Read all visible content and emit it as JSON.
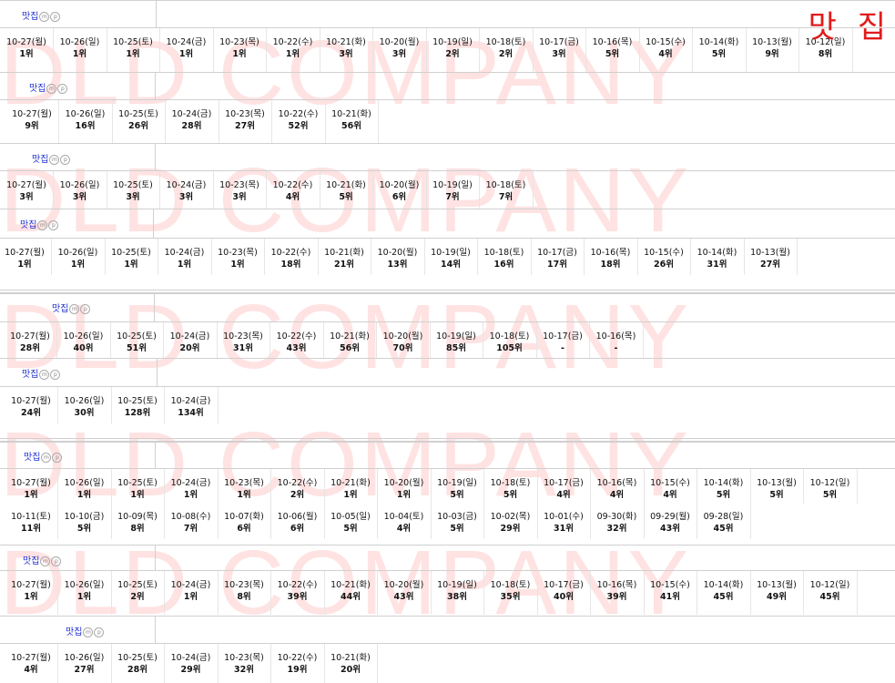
{
  "watermark": "DLD COMPANY",
  "corner_label": "맛 집",
  "icons": [
    "m-icon",
    "p-icon"
  ],
  "blocks": [
    {
      "keyword": "맛집",
      "rows": [
        [
          [
            "10-27(월)",
            "1위"
          ],
          [
            "10-26(일)",
            "1위"
          ],
          [
            "10-25(토)",
            "1위"
          ],
          [
            "10-24(금)",
            "1위"
          ],
          [
            "10-23(목)",
            "1위"
          ],
          [
            "10-22(수)",
            "1위"
          ],
          [
            "10-21(화)",
            "3위"
          ],
          [
            "10-20(월)",
            "3위"
          ],
          [
            "10-19(일)",
            "2위"
          ],
          [
            "10-18(토)",
            "2위"
          ],
          [
            "10-17(금)",
            "3위"
          ],
          [
            "10-16(목)",
            "5위"
          ],
          [
            "10-15(수)",
            "4위"
          ],
          [
            "10-14(화)",
            "5위"
          ],
          [
            "10-13(월)",
            "9위"
          ],
          [
            "10-12(일)",
            "8위"
          ]
        ]
      ]
    },
    {
      "keyword": "맛집",
      "rows": [
        [
          [
            "10-27(월)",
            "9위"
          ],
          [
            "10-26(일)",
            "16위"
          ],
          [
            "10-25(토)",
            "26위"
          ],
          [
            "10-24(금)",
            "28위"
          ],
          [
            "10-23(목)",
            "27위"
          ],
          [
            "10-22(수)",
            "52위"
          ],
          [
            "10-21(화)",
            "56위"
          ]
        ]
      ]
    },
    {
      "keyword": "맛집",
      "rows": [
        [
          [
            "10-27(월)",
            "3위"
          ],
          [
            "10-26(일)",
            "3위"
          ],
          [
            "10-25(토)",
            "3위"
          ],
          [
            "10-24(금)",
            "3위"
          ],
          [
            "10-23(목)",
            "3위"
          ],
          [
            "10-22(수)",
            "4위"
          ],
          [
            "10-21(화)",
            "5위"
          ],
          [
            "10-20(월)",
            "6위"
          ],
          [
            "10-19(일)",
            "7위"
          ],
          [
            "10-18(토)",
            "7위"
          ]
        ]
      ]
    },
    {
      "keyword": "맛집",
      "rows": [
        [
          [
            "10-27(월)",
            "1위"
          ],
          [
            "10-26(일)",
            "1위"
          ],
          [
            "10-25(토)",
            "1위"
          ],
          [
            "10-24(금)",
            "1위"
          ],
          [
            "10-23(목)",
            "1위"
          ],
          [
            "10-22(수)",
            "18위"
          ],
          [
            "10-21(화)",
            "21위"
          ],
          [
            "10-20(월)",
            "13위"
          ],
          [
            "10-19(일)",
            "14위"
          ],
          [
            "10-18(토)",
            "16위"
          ],
          [
            "10-17(금)",
            "17위"
          ],
          [
            "10-16(목)",
            "18위"
          ],
          [
            "10-15(수)",
            "26위"
          ],
          [
            "10-14(화)",
            "31위"
          ],
          [
            "10-13(월)",
            "27위"
          ]
        ]
      ]
    },
    {
      "keyword": "맛집",
      "rows": [
        [
          [
            "10-27(월)",
            "28위"
          ],
          [
            "10-26(일)",
            "40위"
          ],
          [
            "10-25(토)",
            "51위"
          ],
          [
            "10-24(금)",
            "20위"
          ],
          [
            "10-23(목)",
            "31위"
          ],
          [
            "10-22(수)",
            "43위"
          ],
          [
            "10-21(화)",
            "56위"
          ],
          [
            "10-20(월)",
            "70위"
          ],
          [
            "10-19(일)",
            "85위"
          ],
          [
            "10-18(토)",
            "105위"
          ],
          [
            "10-17(금)",
            "-"
          ],
          [
            "10-16(목)",
            "-"
          ]
        ]
      ]
    },
    {
      "keyword": "맛집",
      "rows": [
        [
          [
            "10-27(월)",
            "24위"
          ],
          [
            "10-26(일)",
            "30위"
          ],
          [
            "10-25(토)",
            "128위"
          ],
          [
            "10-24(금)",
            "134위"
          ]
        ]
      ]
    },
    {
      "keyword": "맛집",
      "rows": [
        [
          [
            "10-27(월)",
            "1위"
          ],
          [
            "10-26(일)",
            "1위"
          ],
          [
            "10-25(토)",
            "1위"
          ],
          [
            "10-24(금)",
            "1위"
          ],
          [
            "10-23(목)",
            "1위"
          ],
          [
            "10-22(수)",
            "2위"
          ],
          [
            "10-21(화)",
            "1위"
          ],
          [
            "10-20(월)",
            "1위"
          ],
          [
            "10-19(일)",
            "5위"
          ],
          [
            "10-18(토)",
            "5위"
          ],
          [
            "10-17(금)",
            "4위"
          ],
          [
            "10-16(목)",
            "4위"
          ],
          [
            "10-15(수)",
            "4위"
          ],
          [
            "10-14(화)",
            "5위"
          ],
          [
            "10-13(월)",
            "5위"
          ],
          [
            "10-12(일)",
            "5위"
          ]
        ],
        [
          [
            "10-11(토)",
            "11위"
          ],
          [
            "10-10(금)",
            "5위"
          ],
          [
            "10-09(목)",
            "8위"
          ],
          [
            "10-08(수)",
            "7위"
          ],
          [
            "10-07(화)",
            "6위"
          ],
          [
            "10-06(월)",
            "6위"
          ],
          [
            "10-05(일)",
            "5위"
          ],
          [
            "10-04(토)",
            "4위"
          ],
          [
            "10-03(금)",
            "5위"
          ],
          [
            "10-02(목)",
            "29위"
          ],
          [
            "10-01(수)",
            "31위"
          ],
          [
            "09-30(화)",
            "32위"
          ],
          [
            "09-29(월)",
            "43위"
          ],
          [
            "09-28(일)",
            "45위"
          ]
        ]
      ]
    },
    {
      "keyword": "맛집",
      "rows": [
        [
          [
            "10-27(월)",
            "1위"
          ],
          [
            "10-26(일)",
            "1위"
          ],
          [
            "10-25(토)",
            "2위"
          ],
          [
            "10-24(금)",
            "1위"
          ],
          [
            "10-23(목)",
            "8위"
          ],
          [
            "10-22(수)",
            "39위"
          ],
          [
            "10-21(화)",
            "44위"
          ],
          [
            "10-20(월)",
            "43위"
          ],
          [
            "10-19(일)",
            "38위"
          ],
          [
            "10-18(토)",
            "35위"
          ],
          [
            "10-17(금)",
            "40위"
          ],
          [
            "10-16(목)",
            "39위"
          ],
          [
            "10-15(수)",
            "41위"
          ],
          [
            "10-14(화)",
            "45위"
          ],
          [
            "10-13(월)",
            "49위"
          ],
          [
            "10-12(일)",
            "45위"
          ]
        ]
      ]
    },
    {
      "keyword": "맛집",
      "rows": [
        [
          [
            "10-27(월)",
            "4위"
          ],
          [
            "10-26(일)",
            "27위"
          ],
          [
            "10-25(토)",
            "28위"
          ],
          [
            "10-24(금)",
            "29위"
          ],
          [
            "10-23(목)",
            "32위"
          ],
          [
            "10-22(수)",
            "19위"
          ],
          [
            "10-21(화)",
            "20위"
          ]
        ]
      ]
    }
  ]
}
